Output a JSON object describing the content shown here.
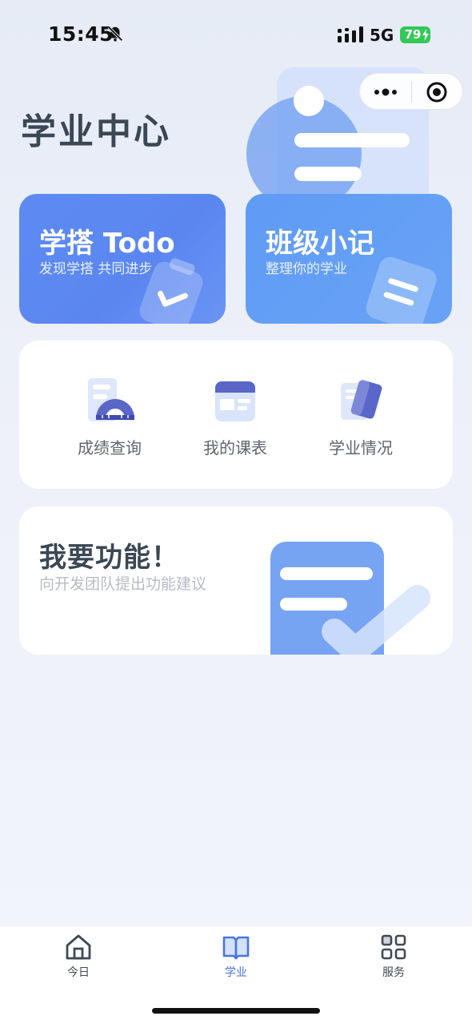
{
  "status_bar": {
    "time": "15:45",
    "network": "5G",
    "battery": "79"
  },
  "page": {
    "title": "学业中心"
  },
  "feature_cards": [
    {
      "title": "学搭 Todo",
      "subtitle": "发现学搭 共同进步"
    },
    {
      "title": "班级小记",
      "subtitle": "整理你的学业"
    }
  ],
  "quick_links": [
    {
      "label": "成绩查询",
      "icon": "grade-report-icon"
    },
    {
      "label": "我的课表",
      "icon": "timetable-icon"
    },
    {
      "label": "学业情况",
      "icon": "academic-status-icon"
    }
  ],
  "request_card": {
    "title": "我要功能！",
    "subtitle": "向开发团队提出功能建议"
  },
  "tab_bar": {
    "items": [
      {
        "label": "今日",
        "icon": "home-icon"
      },
      {
        "label": "学业",
        "icon": "book-icon"
      },
      {
        "label": "服务",
        "icon": "grid-icon"
      }
    ],
    "active_index": 1
  },
  "colors": {
    "accent": "#5b86f0",
    "accent_light": "#69a3f6",
    "battery": "#34c759",
    "title": "#3b4754"
  }
}
